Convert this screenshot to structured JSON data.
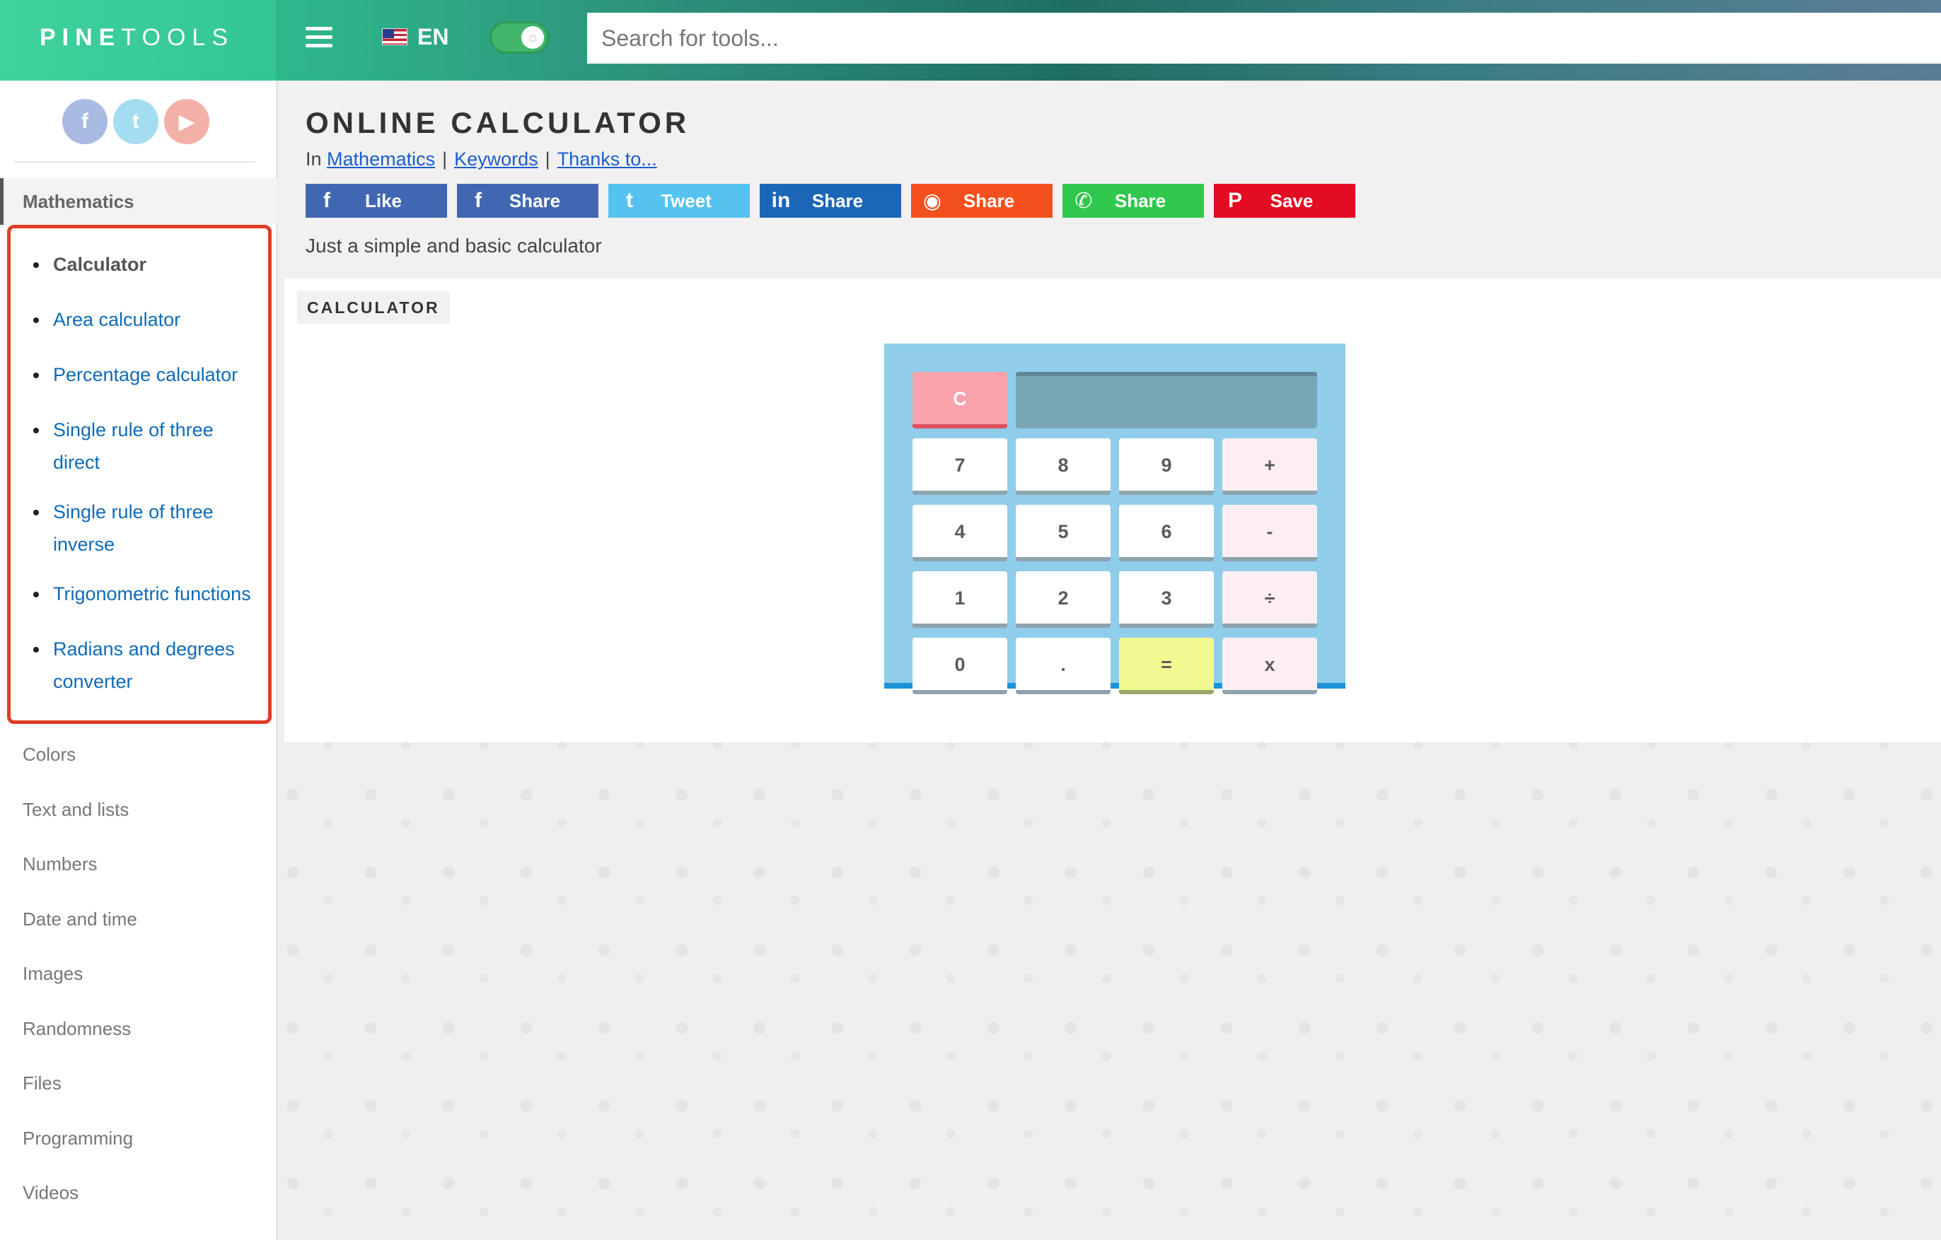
{
  "header": {
    "logo_bold": "PINE",
    "logo_light": "TOOLS",
    "language": "EN",
    "search_placeholder": "Search for tools..."
  },
  "sidebar": {
    "socials": [
      {
        "icon": "facebook-icon",
        "glyph": "f"
      },
      {
        "icon": "twitter-icon",
        "glyph": "t"
      },
      {
        "icon": "youtube-icon",
        "glyph": "▶"
      }
    ],
    "active_category": "Mathematics",
    "subitems": [
      "Calculator",
      "Area calculator",
      "Percentage calculator",
      "Single rule of three direct",
      "Single rule of three inverse",
      "Trigonometric functions",
      "Radians and degrees converter"
    ],
    "categories": [
      "Colors",
      "Text and lists",
      "Numbers",
      "Date and time",
      "Images",
      "Randomness",
      "Files",
      "Programming",
      "Videos"
    ]
  },
  "page": {
    "title": "ONLINE CALCULATOR",
    "in_label": "In",
    "crumb_category": "Mathematics",
    "crumb_keywords": "Keywords",
    "crumb_thanks": "Thanks to...",
    "description": "Just a simple and basic calculator"
  },
  "share": [
    {
      "label": "Like",
      "icon": "facebook-icon",
      "glyph": "f",
      "color": "#4267b2"
    },
    {
      "label": "Share",
      "icon": "facebook-icon",
      "glyph": "f",
      "color": "#4267b2"
    },
    {
      "label": "Tweet",
      "icon": "twitter-icon",
      "glyph": "t",
      "color": "#55c3ee"
    },
    {
      "label": "Share",
      "icon": "linkedin-icon",
      "glyph": "in",
      "color": "#1c66b8"
    },
    {
      "label": "Share",
      "icon": "reddit-icon",
      "glyph": "◉",
      "color": "#f4501d"
    },
    {
      "label": "Share",
      "icon": "whatsapp-icon",
      "glyph": "✆",
      "color": "#2fc84d"
    },
    {
      "label": "Save",
      "icon": "pinterest-icon",
      "glyph": "P",
      "color": "#e30c23"
    }
  ],
  "calculator": {
    "tab_label": "CALCULATOR",
    "clear_label": "C",
    "display": "",
    "keys": [
      [
        "7",
        "8",
        "9",
        "+"
      ],
      [
        "4",
        "5",
        "6",
        "-"
      ],
      [
        "1",
        "2",
        "3",
        "÷"
      ],
      [
        "0",
        ".",
        "=",
        "x"
      ]
    ]
  }
}
